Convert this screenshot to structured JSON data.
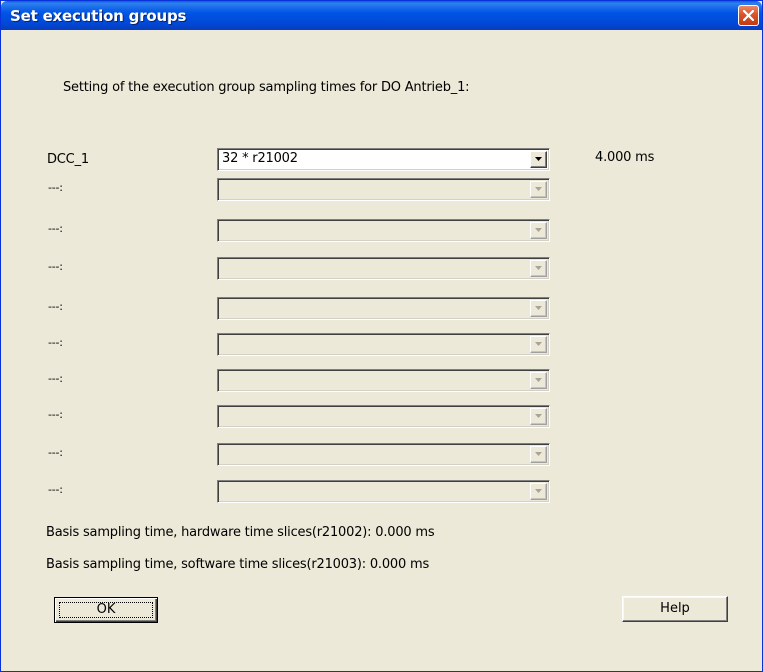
{
  "window": {
    "title": "Set execution groups"
  },
  "intro_text": "Setting of the execution group sampling times for DO  Antrieb_1:",
  "rows": [
    {
      "label": "DCC_1",
      "value": "32 * r21002",
      "time": "4.000  ms",
      "enabled": true
    },
    {
      "label": "---:",
      "value": "",
      "time": "",
      "enabled": false
    },
    {
      "label": "---:",
      "value": "",
      "time": "",
      "enabled": false
    },
    {
      "label": "---:",
      "value": "",
      "time": "",
      "enabled": false
    },
    {
      "label": "---:",
      "value": "",
      "time": "",
      "enabled": false
    },
    {
      "label": "---:",
      "value": "",
      "time": "",
      "enabled": false
    },
    {
      "label": "---:",
      "value": "",
      "time": "",
      "enabled": false
    },
    {
      "label": "---:",
      "value": "",
      "time": "",
      "enabled": false
    },
    {
      "label": "---:",
      "value": "",
      "time": "",
      "enabled": false
    },
    {
      "label": "---:",
      "value": "",
      "time": "",
      "enabled": false
    }
  ],
  "hardware_basis": "Basis sampling time, hardware time slices(r21002): 0.000 ms",
  "software_basis": "Basis sampling time, software time slices(r21003): 0.000 ms",
  "buttons": {
    "ok": "OK",
    "help": "Help"
  },
  "colors": {
    "titlebar": "#0055e5",
    "dialog_bg": "#ece9d8",
    "close_button": "#d8542b"
  },
  "icons": {
    "close": "close-x-icon",
    "dropdown": "dropdown-arrow-icon"
  }
}
